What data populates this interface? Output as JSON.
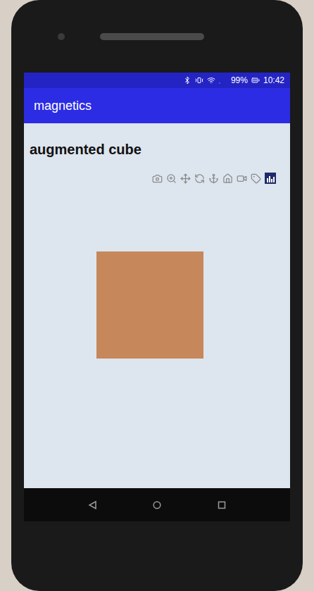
{
  "status_bar": {
    "battery": "99%",
    "time": "10:42"
  },
  "app_bar": {
    "title": "magnetics"
  },
  "page": {
    "title": "augmented cube"
  },
  "toolbar": [
    {
      "selected": false
    },
    {
      "selected": false
    },
    {
      "selected": false
    },
    {
      "selected": false
    },
    {
      "selected": false
    },
    {
      "selected": false
    },
    {
      "selected": false
    },
    {
      "selected": false
    },
    {
      "selected": true
    }
  ]
}
